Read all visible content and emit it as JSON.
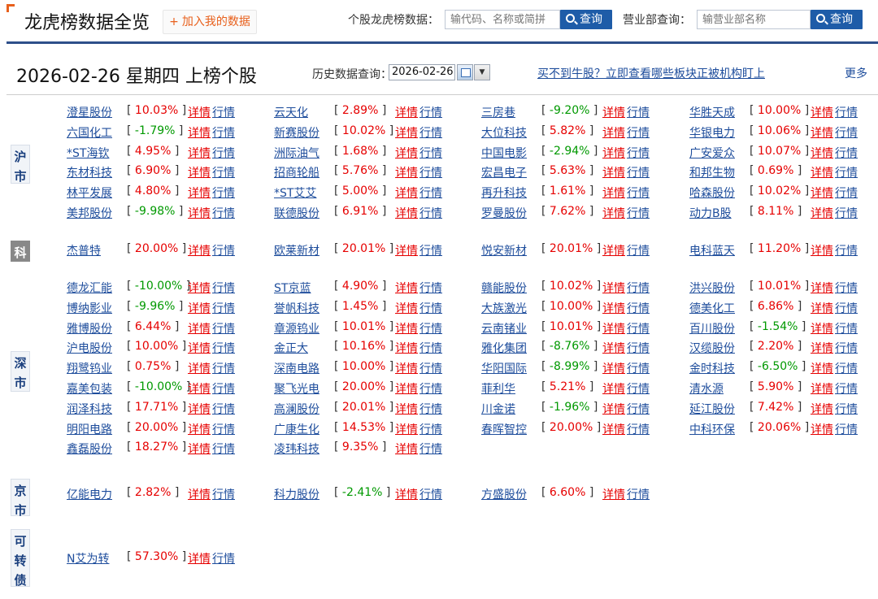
{
  "header": {
    "title": "龙虎榜数据全览",
    "add_label": "加入我的数据",
    "stock_query_label": "个股龙虎榜数据：",
    "stock_query_placeholder": "输代码、名称或简拼",
    "query_button": "查询",
    "branch_query_label": "营业部查询：",
    "branch_query_placeholder": "输营业部名称",
    "accent_color": "#e8601c",
    "brand_color": "#1e5ca8"
  },
  "subheader": {
    "date_title": "2026-02-26 星期四 上榜个股",
    "history_label": "历史数据查询：",
    "history_date": "2026-02-26",
    "promo_link": "买不到牛股？立即查看哪些板块正被机构盯上",
    "more_link": "更多"
  },
  "labels": {
    "detail": "详情",
    "quote": "行情"
  },
  "colors": {
    "up": "#e60000",
    "down": "#009900",
    "link": "#1e4d9c"
  },
  "markets": [
    {
      "tag": "沪市",
      "stocks": [
        {
          "name": "澄星股份",
          "pct": "10.03%"
        },
        {
          "name": "云天化",
          "pct": "2.89%"
        },
        {
          "name": "三房巷",
          "pct": "-9.20%"
        },
        {
          "name": "华胜天成",
          "pct": "10.00%"
        },
        {
          "name": "六国化工",
          "pct": "-1.79%"
        },
        {
          "name": "新赛股份",
          "pct": "10.02%"
        },
        {
          "name": "大位科技",
          "pct": "5.82%"
        },
        {
          "name": "华银电力",
          "pct": "10.06%"
        },
        {
          "name": "*ST海钦",
          "pct": "4.95%"
        },
        {
          "name": "洲际油气",
          "pct": "1.68%"
        },
        {
          "name": "中国电影",
          "pct": "-2.94%"
        },
        {
          "name": "广安爱众",
          "pct": "10.07%"
        },
        {
          "name": "东材科技",
          "pct": "6.90%"
        },
        {
          "name": "招商轮船",
          "pct": "5.76%"
        },
        {
          "name": "宏昌电子",
          "pct": "5.63%"
        },
        {
          "name": "和邦生物",
          "pct": "0.69%"
        },
        {
          "name": "林平发展",
          "pct": "4.80%"
        },
        {
          "name": "*ST艾艾",
          "pct": "5.00%"
        },
        {
          "name": "再升科技",
          "pct": "1.61%"
        },
        {
          "name": "哈森股份",
          "pct": "10.02%"
        },
        {
          "name": "美邦股份",
          "pct": "-9.98%"
        },
        {
          "name": "联德股份",
          "pct": "6.91%"
        },
        {
          "name": "罗曼股份",
          "pct": "7.62%"
        },
        {
          "name": "动力B股",
          "pct": "8.11%"
        }
      ]
    },
    {
      "tag": "科",
      "stocks": [
        {
          "name": "杰普特",
          "pct": "20.00%"
        },
        {
          "name": "欧莱新材",
          "pct": "20.01%"
        },
        {
          "name": "悦安新材",
          "pct": "20.01%"
        },
        {
          "name": "电科蓝天",
          "pct": "11.20%"
        }
      ]
    },
    {
      "tag": "深市",
      "stocks": [
        {
          "name": "德龙汇能",
          "pct": "-10.00%"
        },
        {
          "name": "ST京蓝",
          "pct": "4.90%"
        },
        {
          "name": "赣能股份",
          "pct": "10.02%"
        },
        {
          "name": "洪兴股份",
          "pct": "10.01%"
        },
        {
          "name": "博纳影业",
          "pct": "-9.96%"
        },
        {
          "name": "誉帆科技",
          "pct": "1.45%"
        },
        {
          "name": "大族激光",
          "pct": "10.00%"
        },
        {
          "name": "德美化工",
          "pct": "6.86%"
        },
        {
          "name": "雅博股份",
          "pct": "6.44%"
        },
        {
          "name": "章源钨业",
          "pct": "10.01%"
        },
        {
          "name": "云南锗业",
          "pct": "10.01%"
        },
        {
          "name": "百川股份",
          "pct": "-1.54%"
        },
        {
          "name": "沪电股份",
          "pct": "10.00%"
        },
        {
          "name": "金正大",
          "pct": "10.16%"
        },
        {
          "name": "雅化集团",
          "pct": "-8.76%"
        },
        {
          "name": "汉缆股份",
          "pct": "2.20%"
        },
        {
          "name": "翔鹭钨业",
          "pct": "0.75%"
        },
        {
          "name": "深南电路",
          "pct": "10.00%"
        },
        {
          "name": "华阳国际",
          "pct": "-8.99%"
        },
        {
          "name": "金时科技",
          "pct": "-6.50%"
        },
        {
          "name": "嘉美包装",
          "pct": "-10.00%"
        },
        {
          "name": "聚飞光电",
          "pct": "20.00%"
        },
        {
          "name": "菲利华",
          "pct": "5.21%"
        },
        {
          "name": "清水源",
          "pct": "5.90%"
        },
        {
          "name": "润泽科技",
          "pct": "17.71%"
        },
        {
          "name": "高澜股份",
          "pct": "20.01%"
        },
        {
          "name": "川金诺",
          "pct": "-1.96%"
        },
        {
          "name": "延江股份",
          "pct": "7.42%"
        },
        {
          "name": "明阳电路",
          "pct": "20.00%"
        },
        {
          "name": "广康生化",
          "pct": "14.53%"
        },
        {
          "name": "春晖智控",
          "pct": "20.00%"
        },
        {
          "name": "中科环保",
          "pct": "20.06%"
        },
        {
          "name": "鑫磊股份",
          "pct": "18.27%"
        },
        {
          "name": "凌玮科技",
          "pct": "9.35%"
        }
      ]
    },
    {
      "tag": "京市",
      "stocks": [
        {
          "name": "亿能电力",
          "pct": "2.82%"
        },
        {
          "name": "科力股份",
          "pct": "-2.41%"
        },
        {
          "name": "方盛股份",
          "pct": "6.60%"
        }
      ]
    },
    {
      "tag": "可转债",
      "stocks": [
        {
          "name": "N艾为转",
          "pct": "57.30%"
        }
      ]
    }
  ]
}
